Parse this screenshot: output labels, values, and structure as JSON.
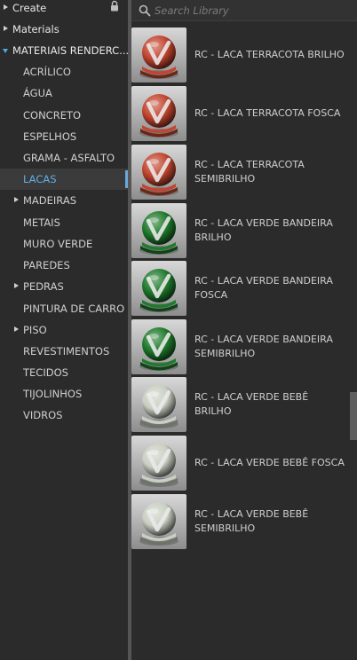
{
  "tree": {
    "items": [
      {
        "label": "Create",
        "level": 0,
        "expander": "collapsed",
        "locked": true
      },
      {
        "label": "Materials",
        "level": 0,
        "expander": "collapsed"
      },
      {
        "label": "MATERIAIS RENDERC...",
        "level": 0,
        "expander": "expanded"
      },
      {
        "label": "ACRÍLICO",
        "level": 1,
        "expander": "none"
      },
      {
        "label": "ÁGUA",
        "level": 1,
        "expander": "none"
      },
      {
        "label": "CONCRETO",
        "level": 1,
        "expander": "none"
      },
      {
        "label": "ESPELHOS",
        "level": 1,
        "expander": "none"
      },
      {
        "label": "GRAMA - ASFALTO",
        "level": 1,
        "expander": "none"
      },
      {
        "label": "LACAS",
        "level": 1,
        "expander": "none",
        "selected": true
      },
      {
        "label": "MADEIRAS",
        "level": 1,
        "expander": "collapsed"
      },
      {
        "label": "METAIS",
        "level": 1,
        "expander": "none"
      },
      {
        "label": "MURO VERDE",
        "level": 1,
        "expander": "none"
      },
      {
        "label": "PAREDES",
        "level": 1,
        "expander": "none"
      },
      {
        "label": "PEDRAS",
        "level": 1,
        "expander": "collapsed"
      },
      {
        "label": "PINTURA DE CARRO",
        "level": 1,
        "expander": "none"
      },
      {
        "label": "PISO",
        "level": 1,
        "expander": "collapsed"
      },
      {
        "label": "REVESTIMENTOS",
        "level": 1,
        "expander": "none"
      },
      {
        "label": "TECIDOS",
        "level": 1,
        "expander": "none"
      },
      {
        "label": "TIJOLINHOS",
        "level": 1,
        "expander": "none"
      },
      {
        "label": "VIDROS",
        "level": 1,
        "expander": "none"
      }
    ]
  },
  "search": {
    "placeholder": "Search Library",
    "value": "",
    "icon": "search-icon"
  },
  "materials": [
    {
      "label": "RC - LACA TERRACOTA BRILHO",
      "color": "#c2452f"
    },
    {
      "label": "RC - LACA TERRACOTA FOSCA",
      "color": "#c2452f"
    },
    {
      "label": "RC - LACA TERRACOTA SEMIBRILHO",
      "color": "#c2452f"
    },
    {
      "label": "RC - LACA VERDE BANDEIRA BRILHO",
      "color": "#1f7a2c"
    },
    {
      "label": "RC - LACA VERDE BANDEIRA FOSCA",
      "color": "#1f7a2c"
    },
    {
      "label": "RC - LACA VERDE BANDEIRA SEMIBRILHO",
      "color": "#1f7a2c"
    },
    {
      "label": "RC - LACA VERDE BEBÊ BRILHO",
      "color": "#c9cfc2"
    },
    {
      "label": "RC - LACA VERDE BEBÊ FOSCA",
      "color": "#c9cfc2"
    },
    {
      "label": "RC - LACA VERDE BEBÊ SEMIBRILHO",
      "color": "#c9cfc2"
    }
  ],
  "colors": {
    "panel_bg": "#2b2b2b",
    "selected_text": "#5fb0e8",
    "expanded_arrow": "#4fa8e3",
    "divider": "#555555"
  },
  "scroll": {
    "position": 0.58
  }
}
